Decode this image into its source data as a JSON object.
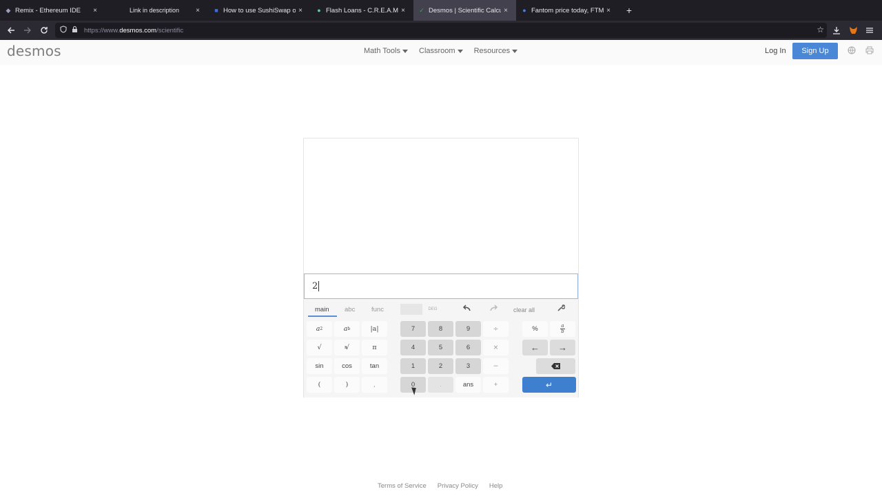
{
  "browser": {
    "tabs": [
      {
        "title": "Remix - Ethereum IDE",
        "favicon": "remix-icon",
        "glyph": "◆",
        "color": "#9aa0b8"
      },
      {
        "title": "Link in description",
        "favicon": "",
        "glyph": "",
        "color": ""
      },
      {
        "title": "How to use SushiSwap on i",
        "favicon": "sushiswap-icon",
        "glyph": "■",
        "color": "#3b6ee6"
      },
      {
        "title": "Flash Loans - C.R.E.A.M. Fi",
        "favicon": "cream-icon",
        "glyph": "●",
        "color": "#5fc9b6"
      },
      {
        "title": "Desmos | Scientific Calcu",
        "favicon": "desmos-icon",
        "glyph": "✓",
        "color": "#3da05a"
      },
      {
        "title": "Fantom price today, FTM t",
        "favicon": "coingecko-icon",
        "glyph": "●",
        "color": "#4a7de8"
      }
    ],
    "tab_close": "×",
    "new_tab": "+",
    "url_prefix": "https://www.",
    "url_domain": "desmos.com",
    "url_path": "/scientific"
  },
  "header": {
    "logo": "desmos",
    "menu": [
      "Math Tools",
      "Classroom",
      "Resources"
    ],
    "login": "Log In",
    "signup": "Sign Up"
  },
  "calculator": {
    "expression": "2",
    "tabs": {
      "main": "main",
      "abc": "abc",
      "func": "func"
    },
    "deg_label": "DEG",
    "clear_all": "clear all",
    "keys": {
      "abs": "|a|",
      "pi": "π",
      "sqrt": "√",
      "nthroot_index": "n",
      "sin": "sin",
      "cos": "cos",
      "tan": "tan",
      "lparen": "(",
      "rparen": ")",
      "comma": ",",
      "n7": "7",
      "n8": "8",
      "n9": "9",
      "div": "÷",
      "n4": "4",
      "n5": "5",
      "n6": "6",
      "mul": "×",
      "n1": "1",
      "n2": "2",
      "n3": "3",
      "minus": "−",
      "n0": "0",
      "dot": ".",
      "ans": "ans",
      "plus": "+",
      "percent": "%",
      "frac_num": "a",
      "frac_den": "b",
      "left": "←",
      "right": "→",
      "enter": "↵"
    }
  },
  "footer": {
    "links": [
      "Terms of Service",
      "Privacy Policy",
      "Help"
    ]
  }
}
